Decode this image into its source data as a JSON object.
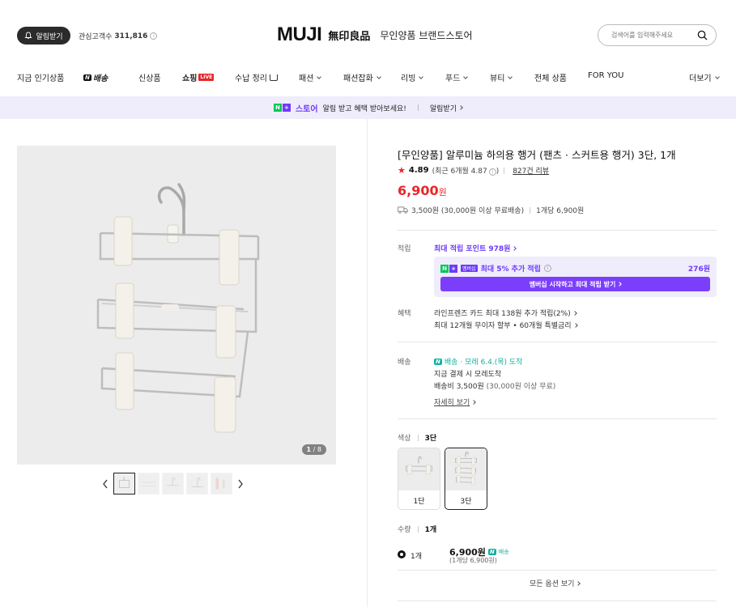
{
  "header": {
    "notify_label": "알림받기",
    "followers_label": "관심고객수",
    "followers_count": "311,816",
    "brand_logo": "MUJI",
    "brand_kanji": "無印良品",
    "brand_name": "무인양품 브랜드스토어",
    "search_placeholder": "검색어를 입력해주세요"
  },
  "nav": {
    "items": [
      {
        "label": "지금 인기상품"
      },
      {
        "label": "배송",
        "badge": "N"
      },
      {
        "label": "신상품"
      },
      {
        "label": "쇼핑",
        "badge": "LIVE"
      },
      {
        "label": "수납 정리"
      },
      {
        "label": "패션"
      },
      {
        "label": "패션잡화"
      },
      {
        "label": "리빙"
      },
      {
        "label": "푸드"
      },
      {
        "label": "뷰티"
      },
      {
        "label": "전체 상품"
      },
      {
        "label": "FOR YOU"
      },
      {
        "label": "더보기"
      }
    ]
  },
  "promo": {
    "n_letter": "N",
    "p_letter": "+",
    "store_label": "스토어",
    "message": "알림 받고 혜택 받아보세요!",
    "link_label": "알림받기"
  },
  "gallery": {
    "counter_current": "1",
    "counter_total": "/ 8"
  },
  "product": {
    "title": "[무인양품] 알루미늄 하의용 행거 (팬츠 · 스커트용 행거) 3단, 1개",
    "star": "★",
    "rating": "4.89",
    "recent_rating": "(최근 6개월 4.87",
    "recent_rating_close": ")",
    "review_count": "827건 리뷰",
    "price": "6,900",
    "price_unit": "원",
    "shipping_fee": "3,500원 (30,000원 이상 무료배송)",
    "unit_price": "1개당 6,900원"
  },
  "points": {
    "label": "적립",
    "max_points": "최대 적립 포인트 978원",
    "membership_badge": "멤버십",
    "membership_text": "최대 5% 추가 적립",
    "membership_amount": "276원",
    "cta_label": "멤버십 시작하고 최대 적립 받기"
  },
  "benefits": {
    "label": "혜택",
    "line1": "라인프렌즈 카드 최대 138원 추가 적립(2%)",
    "line2": "최대 12개월 무이자 할부 • 60개월 특별금리"
  },
  "delivery": {
    "label": "배송",
    "badge": "N",
    "badge_text": "배송",
    "arrival": "· 모레 6.4.(목) 도착",
    "line2": "지금 결제 시 모레도착",
    "fee_label": "배송비 3,500원",
    "fee_note": "(30,000원 이상 무료)",
    "detail_link": "자세히 보기"
  },
  "options": {
    "color_label": "색상",
    "color_selected": "3단",
    "choices": [
      {
        "label": "1단"
      },
      {
        "label": "3단"
      }
    ],
    "qty_label": "수량",
    "qty_selected": "1개",
    "row_qty": "1개",
    "row_price": "6,900원",
    "row_badge": "배송",
    "row_unit": "(1개당 6,900원)",
    "more_label": "모든 옵션 보기"
  },
  "colors": {
    "accent_red": "#e8262a",
    "accent_purple": "#6d3afc",
    "naver_green": "#03c75a",
    "delivery_teal": "#12b0a0"
  }
}
